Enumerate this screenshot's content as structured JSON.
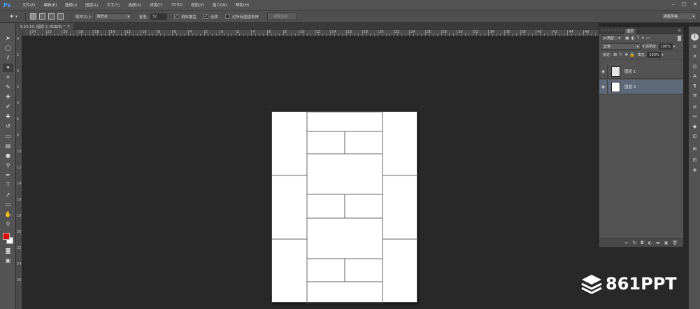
{
  "app": {
    "logo": "Ps"
  },
  "menu": {
    "items": [
      "文件(F)",
      "编辑(E)",
      "图像(I)",
      "图层(L)",
      "文字(Y)",
      "选择(S)",
      "滤镜(T)",
      "3D(D)",
      "视图(V)",
      "窗口(W)",
      "帮助(H)"
    ]
  },
  "window_controls": [
    "–",
    "□",
    "✕"
  ],
  "options_bar": {
    "sample_size_label": "取样大小:",
    "sample_size_value": "取样点",
    "tolerance_label": "容差:",
    "tolerance_value": "32",
    "antialias_label": "消除锯齿",
    "antialias_checked": true,
    "contiguous_label": "连续",
    "contiguous_checked": true,
    "all_layers_label": "对所有图层取样",
    "all_layers_checked": false,
    "refine_edge_label": "调整边缘...",
    "workspace_label": "排版风格"
  },
  "document": {
    "tab_title": "9.23.1% (图层 2, RGB/8) *",
    "tab_close": "×",
    "ruler_h_labels": [
      "24",
      "22",
      "20",
      "18",
      "16",
      "14",
      "12",
      "10",
      "8",
      "6",
      "4",
      "2",
      "0",
      "2",
      "4",
      "6",
      "8",
      "10",
      "12",
      "14",
      "16",
      "18",
      "20",
      "22",
      "24",
      "26",
      "28",
      "30",
      "32",
      "34",
      "36",
      "38",
      "40",
      "42",
      "44",
      "46"
    ],
    "ruler_v_labels": [
      "4",
      "2",
      "0",
      "2",
      "4",
      "6",
      "8",
      "10",
      "12",
      "14",
      "16",
      "18",
      "20",
      "22",
      "24",
      "26"
    ]
  },
  "layers_panel": {
    "tab_label": "图层",
    "kind_filter": "ρ 类型",
    "blend_mode": "正常",
    "opacity_label": "不透明度:",
    "opacity_value": "100%",
    "lock_label": "锁定:",
    "fill_label": "填充:",
    "fill_value": "100%",
    "layers": [
      {
        "name": "图层 1",
        "selected": false
      },
      {
        "name": "图层 2",
        "selected": true
      }
    ],
    "footer_icons": [
      "∞",
      "fx",
      "◘",
      "◐",
      "▬",
      "▣",
      "🗑"
    ]
  },
  "watermark": {
    "text": "861PPT"
  },
  "colors": {
    "foreground": "#e10000",
    "background": "#ffffff",
    "selected_layer": "#5e6a7a",
    "canvas_bg": "#282828"
  }
}
